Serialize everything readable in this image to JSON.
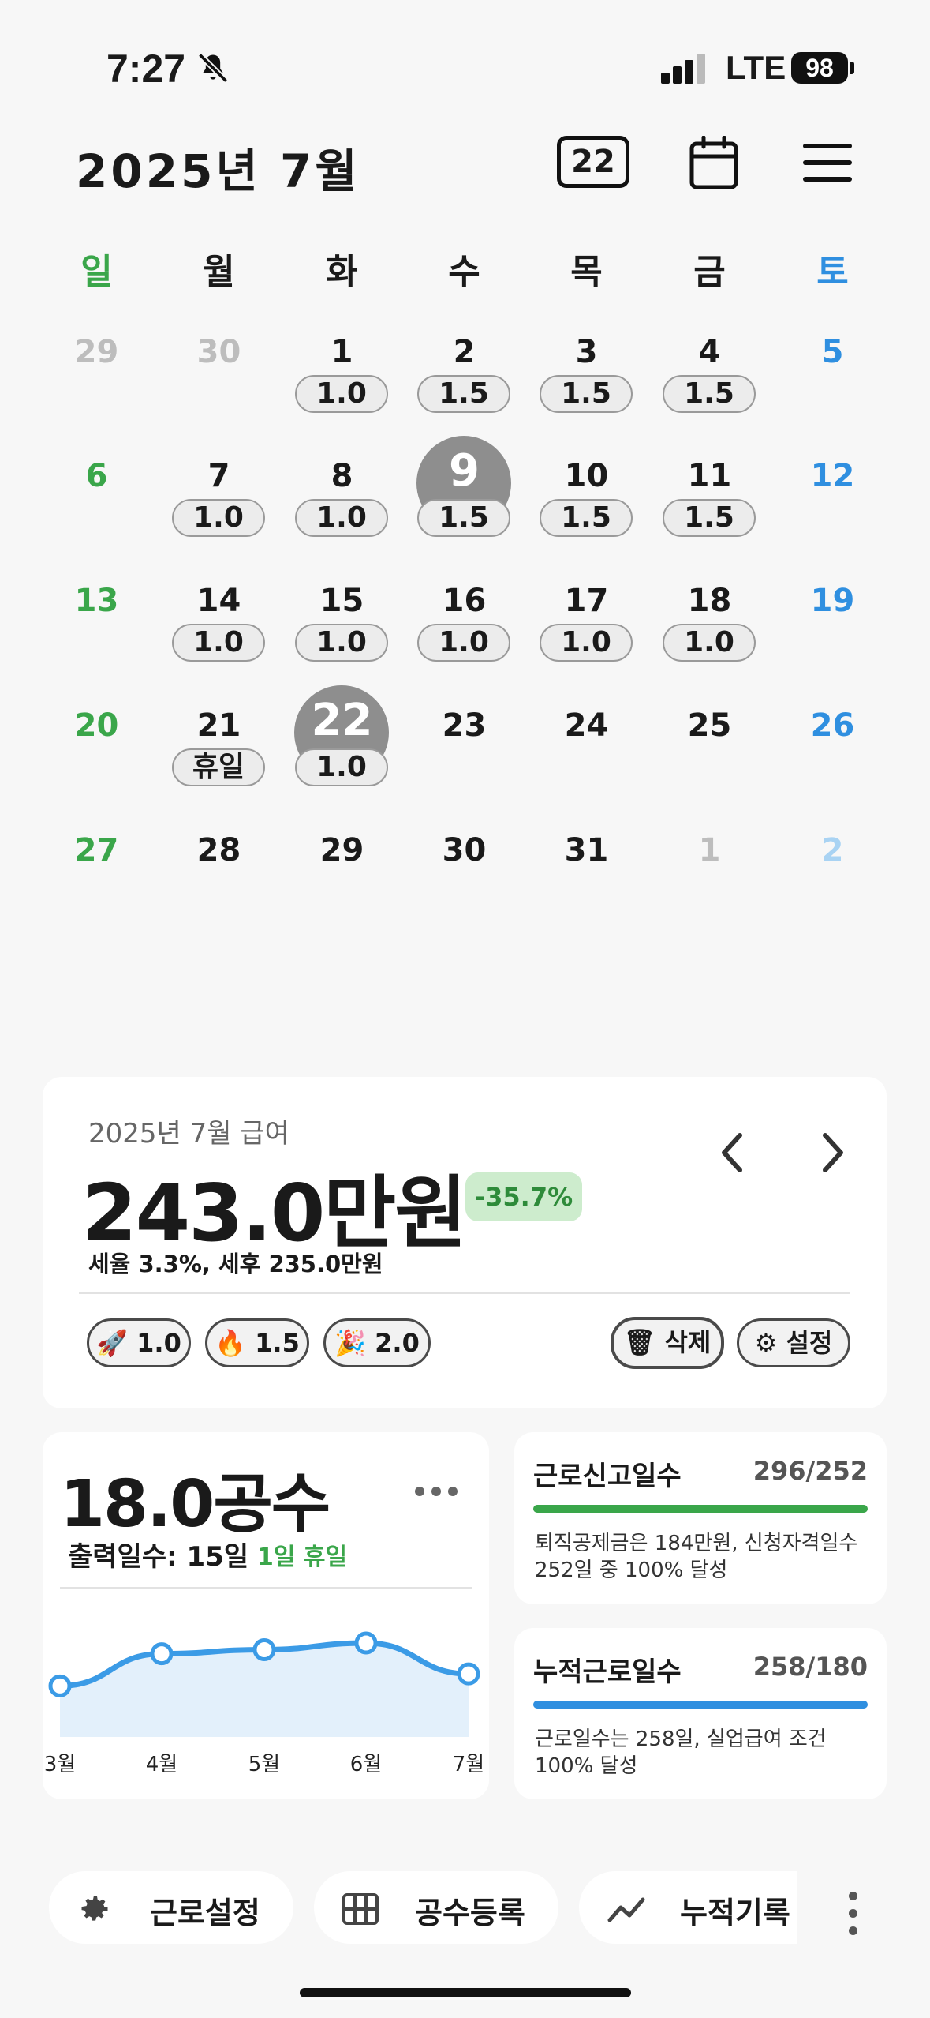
{
  "status_bar": {
    "time": "7:27",
    "network": "LTE",
    "battery": "98"
  },
  "header": {
    "title": "2025년 7월",
    "today_badge": "22"
  },
  "calendar": {
    "weekdays": [
      "일",
      "월",
      "화",
      "수",
      "목",
      "금",
      "토"
    ],
    "weeks": [
      [
        {
          "d": "29",
          "w": ""
        },
        {
          "d": "30",
          "w": ""
        },
        {
          "d": "1",
          "w": "1.0"
        },
        {
          "d": "2",
          "w": "1.5"
        },
        {
          "d": "3",
          "w": "1.5"
        },
        {
          "d": "4",
          "w": "1.5"
        },
        {
          "d": "5",
          "w": ""
        }
      ],
      [
        {
          "d": "6",
          "w": ""
        },
        {
          "d": "7",
          "w": "1.0"
        },
        {
          "d": "8",
          "w": "1.0"
        },
        {
          "d": "9",
          "w": "1.5"
        },
        {
          "d": "10",
          "w": "1.5"
        },
        {
          "d": "11",
          "w": "1.5"
        },
        {
          "d": "12",
          "w": ""
        }
      ],
      [
        {
          "d": "13",
          "w": ""
        },
        {
          "d": "14",
          "w": "1.0"
        },
        {
          "d": "15",
          "w": "1.0"
        },
        {
          "d": "16",
          "w": "1.0"
        },
        {
          "d": "17",
          "w": "1.0"
        },
        {
          "d": "18",
          "w": "1.0"
        },
        {
          "d": "19",
          "w": ""
        }
      ],
      [
        {
          "d": "20",
          "w": ""
        },
        {
          "d": "21",
          "w": "휴일"
        },
        {
          "d": "22",
          "w": "1.0"
        },
        {
          "d": "23",
          "w": ""
        },
        {
          "d": "24",
          "w": ""
        },
        {
          "d": "25",
          "w": ""
        },
        {
          "d": "26",
          "w": ""
        }
      ],
      [
        {
          "d": "27",
          "w": ""
        },
        {
          "d": "28",
          "w": ""
        },
        {
          "d": "29",
          "w": ""
        },
        {
          "d": "30",
          "w": ""
        },
        {
          "d": "31",
          "w": ""
        },
        {
          "d": "1",
          "w": ""
        },
        {
          "d": "2",
          "w": ""
        }
      ]
    ],
    "highlighted_days": [
      "9",
      "22"
    ],
    "colors": {
      "sunday": "#3aa64a",
      "saturday": "#2f8fe0",
      "other_month": "#bdbdbd",
      "other_month_sat": "#a9d3f3",
      "highlight": "#8e8e8e"
    }
  },
  "salary": {
    "label": "2025년 7월 급여",
    "amount": "243.0만원",
    "change": "-35.7%",
    "tax_note": "세율 3.3%, 세후 235.0만원",
    "rates": [
      {
        "icon": "rocket-icon",
        "value": "1.0"
      },
      {
        "icon": "fire-icon",
        "value": "1.5"
      },
      {
        "icon": "party-icon",
        "value": "2.0"
      }
    ],
    "delete_label": "삭제",
    "settings_label": "설정"
  },
  "work": {
    "total": "18.0공수",
    "days_label": "출력일수: 15일",
    "holiday": "1일 휴일",
    "chart_data": {
      "type": "area",
      "categories": [
        "3월",
        "4월",
        "5월",
        "6월",
        "7월"
      ],
      "values": [
        0.38,
        0.62,
        0.65,
        0.7,
        0.47
      ]
    }
  },
  "report_days": {
    "title": "근로신고일수",
    "count": "296/252",
    "progress": 1.0,
    "description": "퇴직공제금은 184만원, 신청자격일수 252일 중 100% 달성",
    "color": "#3aa64a"
  },
  "cumulative_days": {
    "title": "누적근로일수",
    "count": "258/180",
    "progress": 1.0,
    "description": "근로일수는 258일, 실업급여 조건 100% 달성",
    "color": "#2f8fe0"
  },
  "bottom_nav": [
    {
      "icon": "gear-icon",
      "label": "근로설정"
    },
    {
      "icon": "grid-icon",
      "label": "공수등록"
    },
    {
      "icon": "trend-icon",
      "label": "누적기록"
    }
  ]
}
